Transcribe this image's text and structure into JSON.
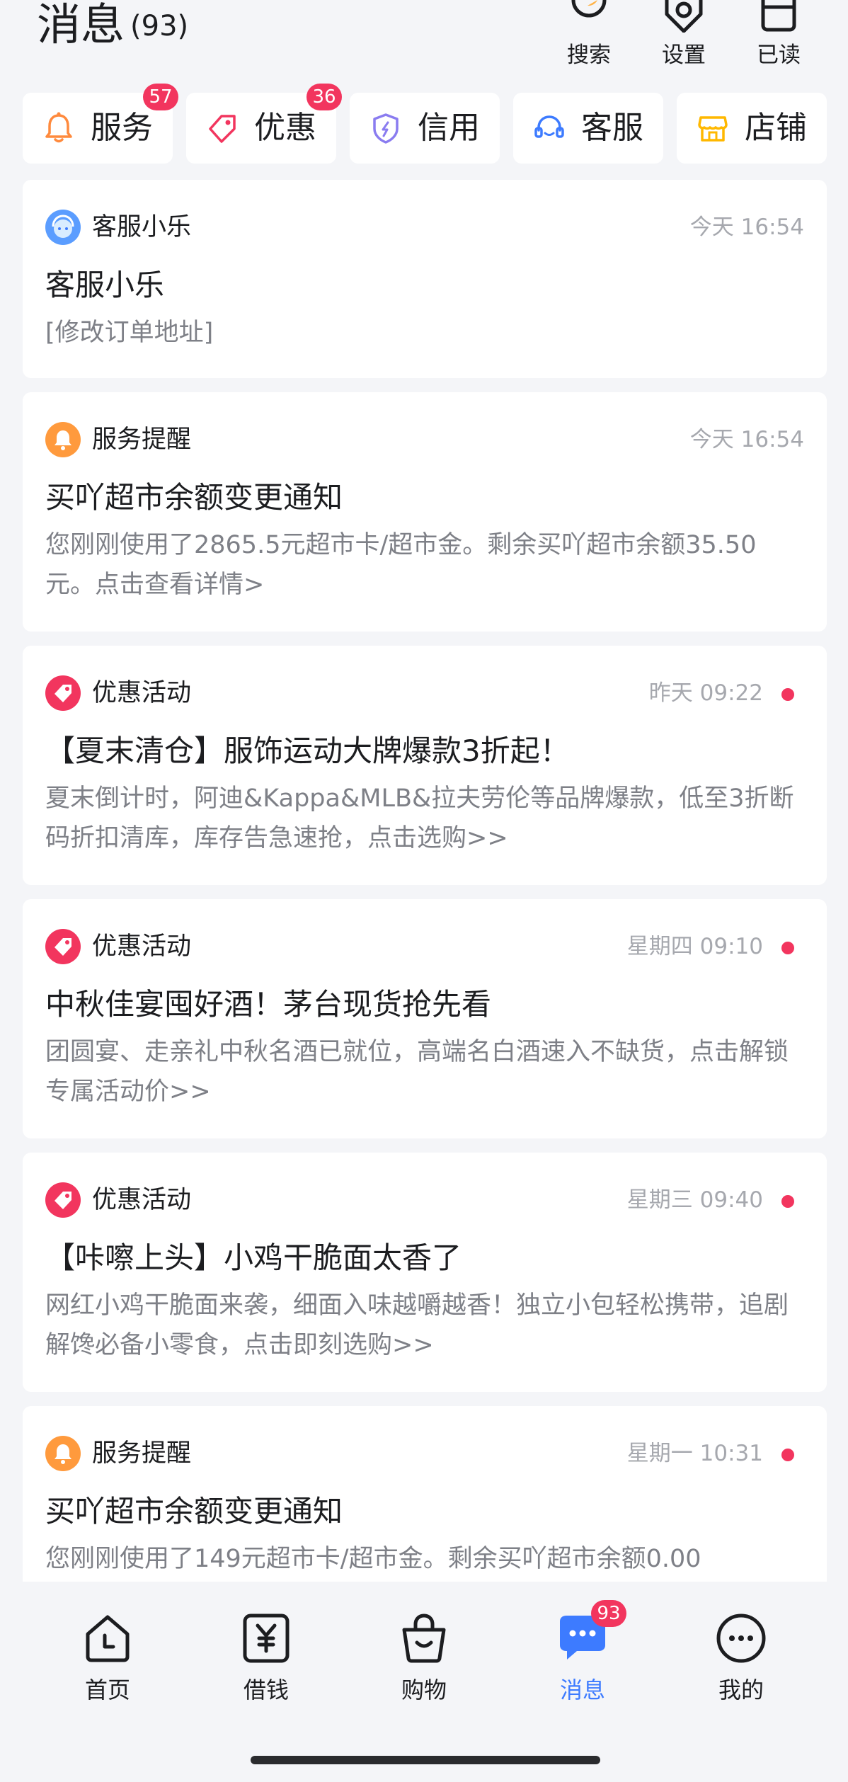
{
  "header": {
    "title": "消息",
    "count": "(93)",
    "actions": [
      {
        "label": "搜索",
        "icon": "search-icon"
      },
      {
        "label": "设置",
        "icon": "gear-icon"
      },
      {
        "label": "已读",
        "icon": "mark-read-icon"
      }
    ]
  },
  "categories": [
    {
      "label": "服务",
      "icon": "bell-icon",
      "badge": "57"
    },
    {
      "label": "优惠",
      "icon": "tag-icon",
      "badge": "36"
    },
    {
      "label": "信用",
      "icon": "shield-icon",
      "badge": ""
    },
    {
      "label": "客服",
      "icon": "headset-icon",
      "badge": ""
    },
    {
      "label": "店铺",
      "icon": "store-icon",
      "badge": ""
    }
  ],
  "messages": [
    {
      "source": "客服小乐",
      "icon": "customer-service-avatar-icon",
      "time": "今天 16:54",
      "title": "客服小乐",
      "body": "[修改订单地址]",
      "unread": false
    },
    {
      "source": "服务提醒",
      "icon": "service-bell-icon",
      "time": "今天 16:54",
      "title": "买吖超市余额变更通知",
      "body": "您刚刚使用了2865.5元超市卡/超市金。剩余买吖超市余额35.50元。点击查看详情>",
      "unread": false
    },
    {
      "source": "优惠活动",
      "icon": "promo-tag-icon",
      "time": "昨天 09:22",
      "title": "【夏末清仓】服饰运动大牌爆款3折起！",
      "body": "夏末倒计时，阿迪&Kappa&MLB&拉夫劳伦等品牌爆款，低至3折断码折扣清库，库存告急速抢，点击选购>>",
      "unread": true
    },
    {
      "source": "优惠活动",
      "icon": "promo-tag-icon",
      "time": "星期四 09:10",
      "title": "中秋佳宴囤好酒！茅台现货抢先看",
      "body": "团圆宴、走亲礼中秋名酒已就位，高端名白酒速入不缺货，点击解锁专属活动价>>",
      "unread": true
    },
    {
      "source": "优惠活动",
      "icon": "promo-tag-icon",
      "time": "星期三 09:40",
      "title": "【咔嚓上头】小鸡干脆面太香了",
      "body": "网红小鸡干脆面来袭，细面入味越嚼越香！独立小包轻松携带，追剧解馋必备小零食，点击即刻选购>>",
      "unread": true
    },
    {
      "source": "服务提醒",
      "icon": "service-bell-icon",
      "time": "星期一 10:31",
      "title": "买吖超市余额变更通知",
      "body": "您刚刚使用了149元超市卡/超市金。剩余买吖超市余额0.00",
      "unread": true
    }
  ],
  "bottom_nav": [
    {
      "label": "首页",
      "icon": "home-icon",
      "active": false
    },
    {
      "label": "借钱",
      "icon": "yuan-icon",
      "active": false
    },
    {
      "label": "购物",
      "icon": "shopping-bag-icon",
      "active": false
    },
    {
      "label": "消息",
      "icon": "chat-icon",
      "active": true,
      "badge": "93"
    },
    {
      "label": "我的",
      "icon": "profile-icon",
      "active": false
    }
  ],
  "colors": {
    "accent": "#3d7bff",
    "badge": "#f2355e",
    "background": "#f4f5f8",
    "service_orange": "#ff9a3d",
    "promo_pink": "#f2355e"
  }
}
